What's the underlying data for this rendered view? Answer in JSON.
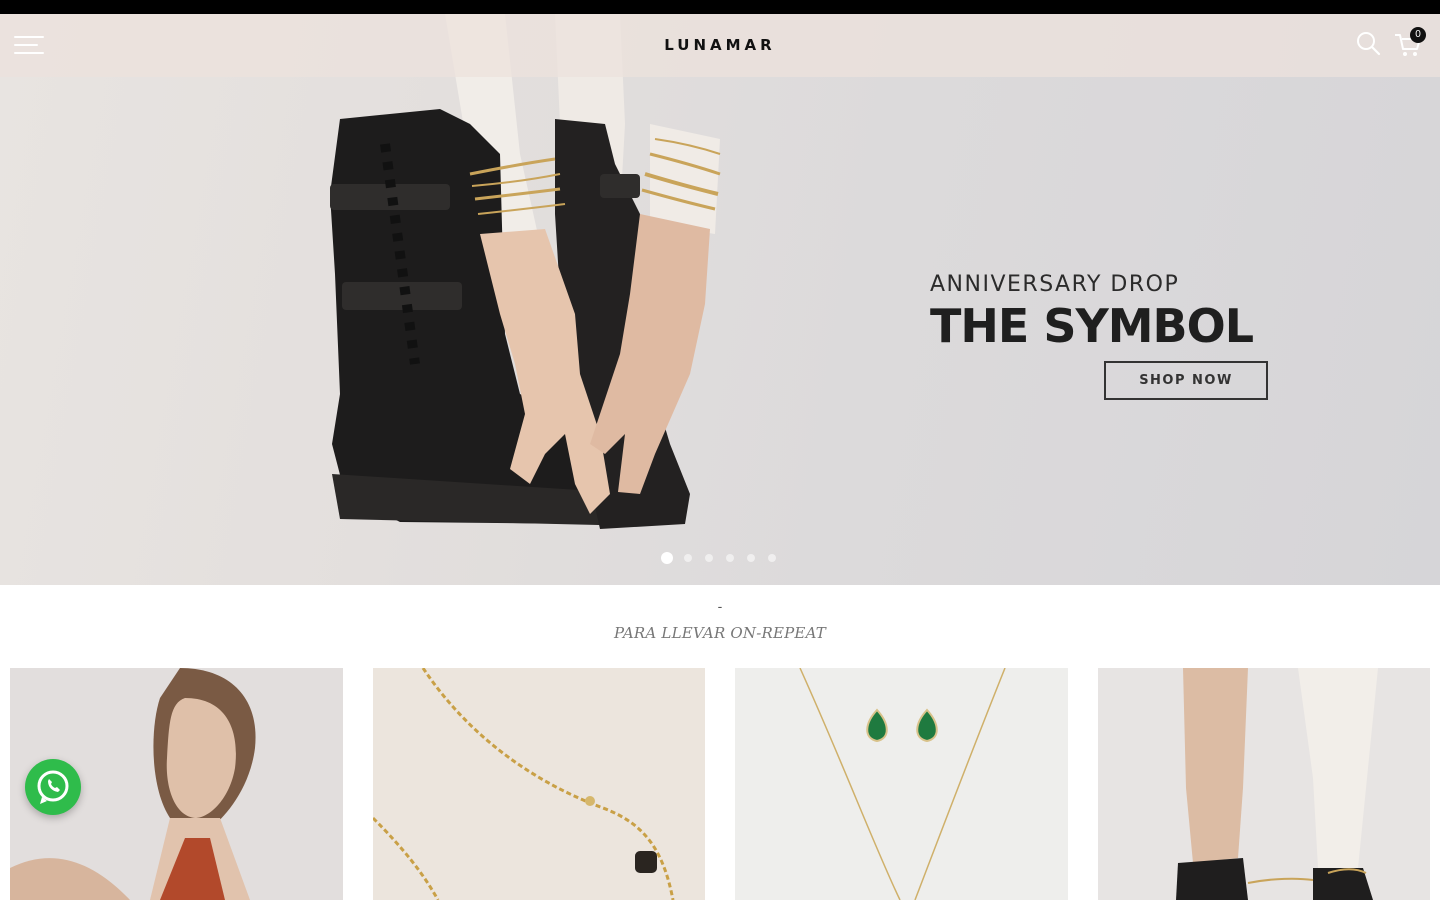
{
  "header": {
    "brand": "LUNAMAR",
    "cart_count": "0"
  },
  "hero": {
    "kicker": "ANNIVERSARY DROP",
    "title": "THE SYMBOL",
    "cta_label": "SHOP NOW",
    "slides_total": 6,
    "active_slide": 1
  },
  "section": {
    "dash": "-",
    "title": "PARA LLEVAR ON-REPEAT"
  },
  "icons": {
    "menu": "hamburger-menu-icon",
    "search": "search-icon",
    "cart": "shopping-cart-icon",
    "whatsapp": "whatsapp-icon"
  },
  "colors": {
    "whatsapp_green": "#2fbc4b",
    "header_overlay": "#ece2dc",
    "text_dark": "#1f1f1f"
  }
}
